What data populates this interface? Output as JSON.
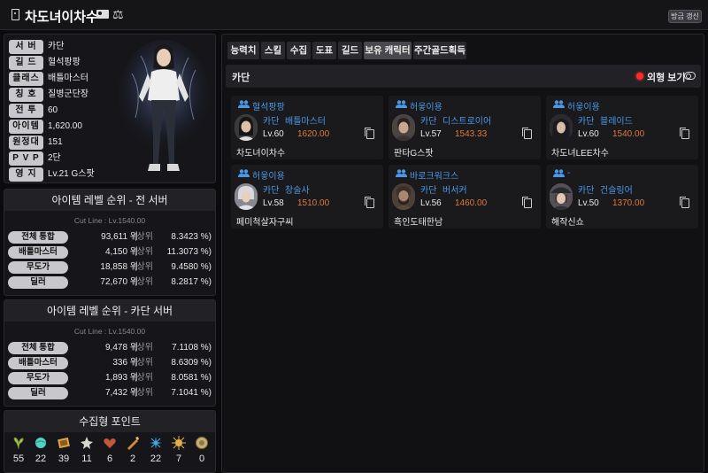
{
  "header": {
    "bookmark_icon": "bookmark-icon",
    "title": "차도녀이차수",
    "id_card_icon": "id-card-icon",
    "scale_icon": "scale-icon",
    "refresh_label": "방금 갱신"
  },
  "profile": {
    "rows": [
      {
        "key": "서 버",
        "value": "카단"
      },
      {
        "key": "길 드",
        "value": "혈석팡팡"
      },
      {
        "key": "클래스",
        "value": "배틀마스터"
      },
      {
        "key": "칭 호",
        "value": "질병군단장"
      },
      {
        "key": "전 투",
        "value": "60"
      },
      {
        "key": "아이템",
        "value": "1,620.00"
      },
      {
        "key": "원정대",
        "value": "151"
      },
      {
        "key": "P V P",
        "value": "2단"
      },
      {
        "key": "영 지",
        "value": "Lv.21 G스팟"
      }
    ]
  },
  "rank_all": {
    "title": "아이템 레벨 순위 - 전 서버",
    "cutline": "Cut Line : Lv.1540.00",
    "rows": [
      {
        "label": "전체 통합",
        "rank": "93,611 위",
        "suffix": "(상위",
        "pct": "8.3423 %)"
      },
      {
        "label": "배틀마스터",
        "rank": "4,150 위",
        "suffix": "(상위",
        "pct": "11.3073 %)"
      },
      {
        "label": "무도가",
        "rank": "18,858 위",
        "suffix": "(상위",
        "pct": "9.4580 %)"
      },
      {
        "label": "딜러",
        "rank": "72,670 위",
        "suffix": "(상위",
        "pct": "8.2817 %)"
      }
    ]
  },
  "rank_server": {
    "title": "아이템 레벨 순위 - 카단 서버",
    "cutline": "Cut Line : Lv.1540.00",
    "rows": [
      {
        "label": "전체 통합",
        "rank": "9,478 위",
        "suffix": "(상위",
        "pct": "7.1108 %)"
      },
      {
        "label": "배틀마스터",
        "rank": "336 위",
        "suffix": "(상위",
        "pct": "8.6309 %)"
      },
      {
        "label": "무도가",
        "rank": "1,893 위",
        "suffix": "(상위",
        "pct": "8.0581 %)"
      },
      {
        "label": "딜러",
        "rank": "7,432 위",
        "suffix": "(상위",
        "pct": "7.1041 %)"
      }
    ]
  },
  "collectibles": {
    "title": "수집형 포인트",
    "items": [
      {
        "icon": "mokoko-seed-icon",
        "count": "55",
        "color": "#a7c34a"
      },
      {
        "icon": "island-heart-icon",
        "count": "22",
        "color": "#4fd3c0"
      },
      {
        "icon": "great-art-icon",
        "count": "39",
        "color": "#d9a64a"
      },
      {
        "icon": "omnium-star-icon",
        "count": "11",
        "color": "#d8d8c8"
      },
      {
        "icon": "giant-heart-icon",
        "count": "6",
        "color": "#c0583a"
      },
      {
        "icon": "ignea-token-icon",
        "count": "2",
        "color": "#d08a3a"
      },
      {
        "icon": "sea-bounty-icon",
        "count": "22",
        "color": "#4aa8e8"
      },
      {
        "icon": "world-tree-leaf-icon",
        "count": "7",
        "color": "#e0b04a"
      },
      {
        "icon": "orpheus-star-icon",
        "count": "0",
        "color": "#c8b070"
      }
    ]
  },
  "tabs": [
    {
      "label": "능력치"
    },
    {
      "label": "스킬"
    },
    {
      "label": "수집"
    },
    {
      "label": "도표"
    },
    {
      "label": "길드"
    },
    {
      "label": "보유 캐릭터"
    },
    {
      "label": "주간골드획득"
    }
  ],
  "server_section": {
    "title": "카단",
    "appearance_label": "외형 보기"
  },
  "characters": [
    {
      "guild": "혈석팡팡",
      "server": "카단",
      "class": "배틀마스터",
      "level": "Lv.60",
      "item_level": "1620.00",
      "name": "차도녀이차수",
      "portrait": "avatar-female-dark"
    },
    {
      "guild": "허읗이용",
      "server": "카단",
      "class": "디스트로이어",
      "level": "Lv.57",
      "item_level": "1543.33",
      "name": "판타G스팟",
      "portrait": "avatar-male-dark"
    },
    {
      "guild": "허읗이용",
      "server": "카단",
      "class": "블레이드",
      "level": "Lv.60",
      "item_level": "1540.00",
      "name": "차도녀LEE차수",
      "portrait": "avatar-female-hood"
    },
    {
      "guild": "허읗이용",
      "server": "카단",
      "class": "창술사",
      "level": "Lv.58",
      "item_level": "1510.00",
      "name": "페미척살자구씨",
      "portrait": "avatar-female-light"
    },
    {
      "guild": "바로크워크스",
      "server": "카단",
      "class": "버서커",
      "level": "Lv.56",
      "item_level": "1460.00",
      "name": "흑인도태한남",
      "portrait": "avatar-male-beard"
    },
    {
      "guild": "-",
      "server": "카단",
      "class": "건슬링어",
      "level": "Lv.50",
      "item_level": "1370.00",
      "name": "해작신쇼",
      "portrait": "avatar-female-hat"
    }
  ]
}
